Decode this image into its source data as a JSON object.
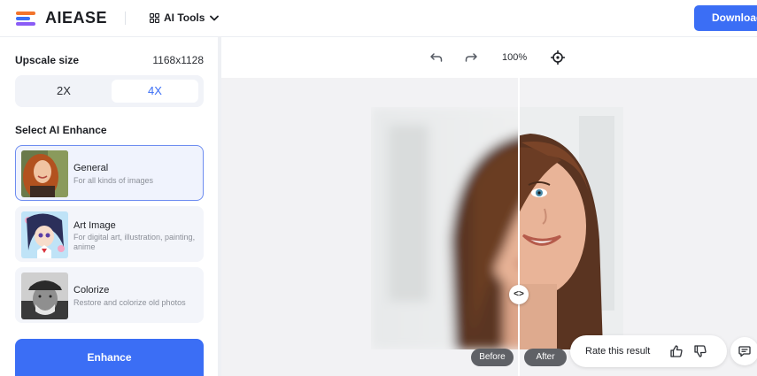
{
  "header": {
    "logo_text": "AIEASE",
    "tools_label": "AI Tools",
    "download_label": "Download"
  },
  "sidebar": {
    "upscale_label": "Upscale size",
    "upscale_value": "1168x1128",
    "scale_options": [
      "2X",
      "4X"
    ],
    "selected_scale": "4X",
    "select_label": "Select AI Enhance",
    "modes": [
      {
        "title": "General",
        "desc": "For all kinds of images",
        "selected": true
      },
      {
        "title": "Art Image",
        "desc": "For digital art, illustration, painting, anime",
        "selected": false
      },
      {
        "title": "Colorize",
        "desc": "Restore and colorize old photos",
        "selected": false
      }
    ],
    "enhance_label": "Enhance"
  },
  "toolbar": {
    "zoom": "100%",
    "icons": [
      "undo-icon",
      "redo-icon",
      "fit-target-icon"
    ]
  },
  "compare": {
    "before_label": "Before",
    "after_label": "After",
    "handle_label": "<>"
  },
  "rating": {
    "text": "Rate this result",
    "icons": [
      "thumbs-up-icon",
      "thumbs-down-icon",
      "feedback-icon"
    ]
  },
  "colors": {
    "accent": "#3b6ef5",
    "logo_orange": "#f2742c",
    "logo_blue": "#3b6ef5",
    "logo_purple": "#8a5cf6"
  }
}
